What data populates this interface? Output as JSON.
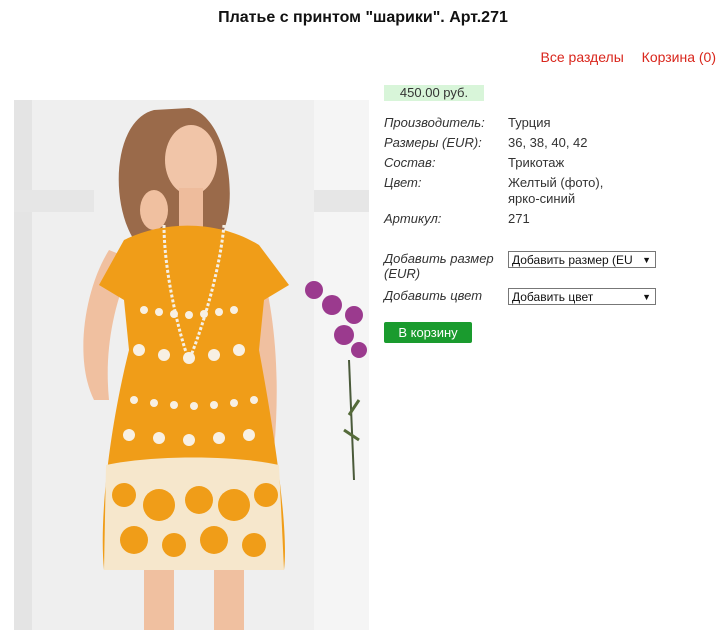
{
  "page": {
    "title": "Платье с принтом \"шарики\". Арт.271"
  },
  "nav": {
    "all_sections": "Все разделы",
    "cart": "Корзина (0)"
  },
  "product": {
    "price": "450.00 руб.",
    "specs": [
      {
        "label": "Производитель:",
        "value": "Турция"
      },
      {
        "label": "Размеры (EUR):",
        "value": "36, 38, 40, 42"
      },
      {
        "label": "Состав:",
        "value": "Трикотаж"
      },
      {
        "label": "Цвет:",
        "value": "Желтый (фото), ярко-синий"
      },
      {
        "label": "Артикул:",
        "value": "271"
      }
    ],
    "add_size_label": "Добавить размер (EUR)",
    "add_size_select": "Добавить размер (EU",
    "add_color_label": "Добавить цвет",
    "add_color_select": "Добавить цвет",
    "add_to_cart": "В корзину",
    "accent_color": "#1a9b2e",
    "price_bg": "#d8f5d9",
    "link_color": "#d9261c"
  }
}
